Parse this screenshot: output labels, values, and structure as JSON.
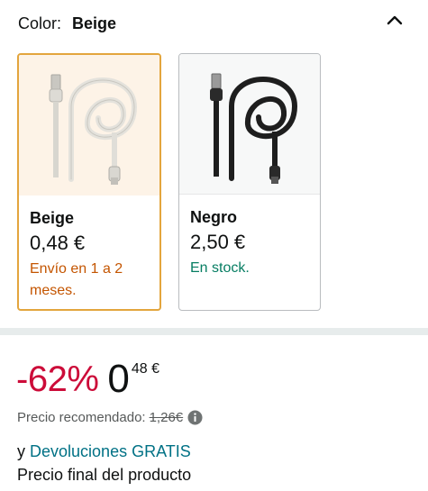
{
  "color_selector": {
    "label": "Color:",
    "selected_value": "Beige",
    "collapse_icon": "chevron-up-icon",
    "options": [
      {
        "name": "Beige",
        "price": "0,48 €",
        "availability": "Envío en 1 a 2 meses.",
        "availability_color": "#c45500",
        "selected": true,
        "cable_color": "#e4e2dc"
      },
      {
        "name": "Negro",
        "price": "2,50 €",
        "availability": "En stock.",
        "availability_color": "#067d62",
        "selected": false,
        "cable_color": "#1e1e1e"
      }
    ]
  },
  "pricing": {
    "discount": "-62%",
    "price_whole": "0",
    "price_fraction": "48 €",
    "recommended_label": "Precio recomendado:",
    "recommended_value": "1,26€",
    "info_icon": "info-icon"
  },
  "returns": {
    "prefix": "y",
    "link": "Devoluciones GRATIS"
  },
  "final_price_note": "Precio final del producto",
  "colors": {
    "accent_border": "#e3a53d",
    "discount_red": "#cc0c39",
    "link_teal": "#007185",
    "in_stock_green": "#067d62",
    "shipping_orange": "#c45500"
  }
}
